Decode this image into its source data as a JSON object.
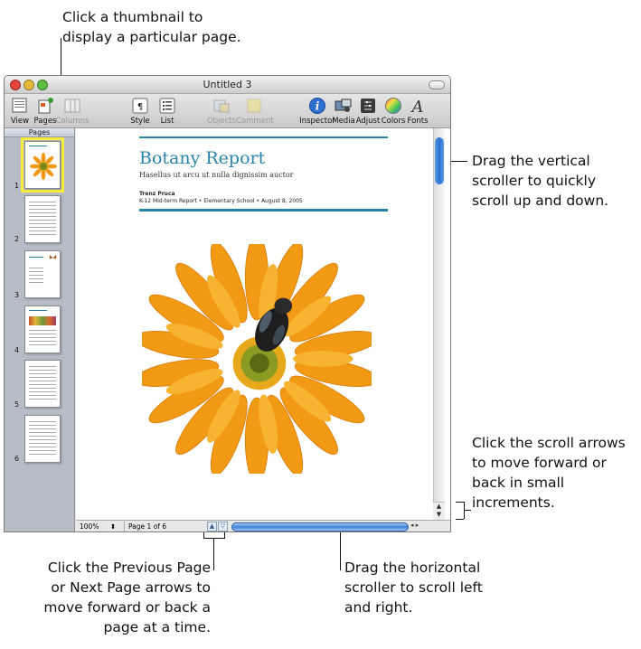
{
  "callouts": {
    "thumbnail": [
      "Click a thumbnail to",
      "display a particular page."
    ],
    "vertical_scroller": [
      "Drag the vertical",
      "scroller to quickly",
      "scroll up and down."
    ],
    "scroll_arrows": [
      "Click the scroll arrows",
      "to move forward or",
      "back in small",
      "increments."
    ],
    "page_arrows": [
      "Click the Previous Page",
      "or Next Page arrows to",
      "move forward or back a",
      "page at a time."
    ],
    "horizontal_scroller": [
      "Drag the horizontal",
      "scroller to scroll left",
      "and right."
    ]
  },
  "window": {
    "title": "Untitled 3",
    "traffic_colors": {
      "close": "#e0463d",
      "minimize": "#e6b83a",
      "zoom": "#5fbf45"
    }
  },
  "toolbar": {
    "items": [
      {
        "label": "View",
        "icon": "view-icon",
        "enabled": true
      },
      {
        "label": "Pages",
        "icon": "pages-icon",
        "enabled": true
      },
      {
        "label": "Columns",
        "icon": "columns-icon",
        "enabled": false
      },
      {
        "label": "Style",
        "icon": "paragraph-style-icon",
        "enabled": true
      },
      {
        "label": "List",
        "icon": "list-icon",
        "enabled": true
      },
      {
        "label": "Objects",
        "icon": "objects-icon",
        "enabled": false
      },
      {
        "label": "Comment",
        "icon": "comment-icon",
        "enabled": false
      },
      {
        "label": "Inspector",
        "icon": "inspector-icon",
        "enabled": true
      },
      {
        "label": "Media",
        "icon": "media-icon",
        "enabled": true
      },
      {
        "label": "Adjust",
        "icon": "adjust-icon",
        "enabled": true
      },
      {
        "label": "Colors",
        "icon": "colors-icon",
        "enabled": true
      },
      {
        "label": "Fonts",
        "icon": "fonts-icon",
        "enabled": true
      }
    ]
  },
  "sidebar": {
    "header": "Pages",
    "thumbnails": [
      {
        "number": "1",
        "selected": true
      },
      {
        "number": "2",
        "selected": false
      },
      {
        "number": "3",
        "selected": false
      },
      {
        "number": "4",
        "selected": false
      },
      {
        "number": "5",
        "selected": false
      },
      {
        "number": "6",
        "selected": false
      }
    ]
  },
  "document": {
    "title": "Botany Report",
    "subtitle": "Hasellus ut arcu ut nulla dignissim auctor",
    "author": "Trenz Pruca",
    "meta": "K-12 Mid-term Report • Elementary School • August 8, 2005",
    "accent_color": "#2a83a8"
  },
  "statusbar": {
    "zoom": "100%",
    "page_indicator": "Page 1 of 6",
    "previous_page": "▲",
    "next_page": "▽"
  },
  "accent": "#3f82d9"
}
